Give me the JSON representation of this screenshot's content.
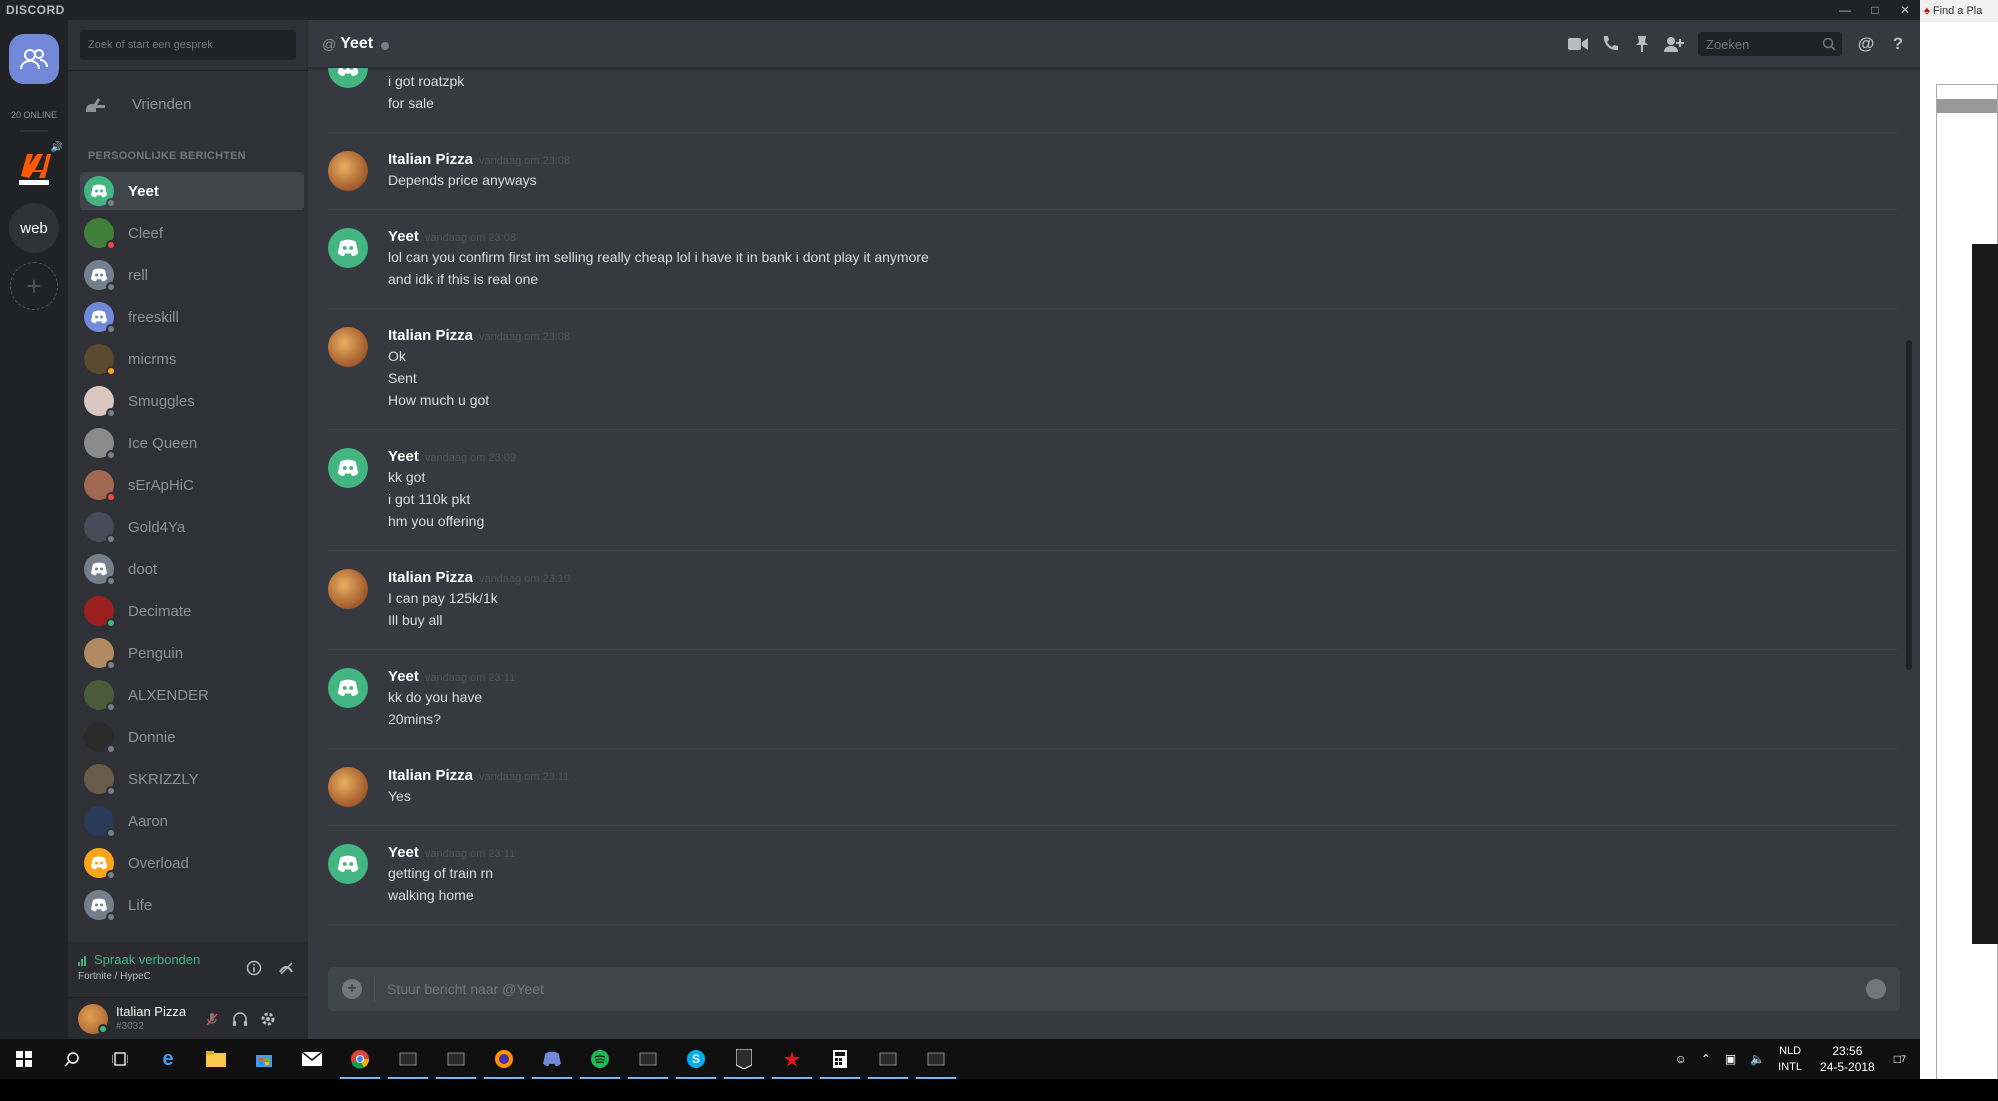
{
  "app": {
    "brand": "DISCORD"
  },
  "guilds": {
    "online_count": "20 ONLINE",
    "web_label": "web",
    "add_label": "+"
  },
  "sidebar": {
    "search_placeholder": "Zoek of start een gesprek",
    "friends_label": "Vrienden",
    "dm_header": "PERSOONLIJKE BERICHTEN",
    "dms": [
      {
        "name": "Yeet",
        "status": "offline",
        "active": true,
        "avatar": "#43b581"
      },
      {
        "name": "Cleef",
        "status": "dnd",
        "active": false,
        "avatar": "#3f7f3a"
      },
      {
        "name": "rell",
        "status": "offline",
        "active": false,
        "avatar": "#747f8d"
      },
      {
        "name": "freeskill",
        "status": "offline",
        "active": false,
        "avatar": "#7289da"
      },
      {
        "name": "micrms",
        "status": "idle",
        "active": false,
        "avatar": "#5a4a2e"
      },
      {
        "name": "Smuggles",
        "status": "offline",
        "active": false,
        "avatar": "#d9c7c0"
      },
      {
        "name": "Ice Queen",
        "status": "offline",
        "active": false,
        "avatar": "#8a8a8a"
      },
      {
        "name": "sErApHiC",
        "status": "dnd",
        "active": false,
        "avatar": "#a06850"
      },
      {
        "name": "Gold4Ya",
        "status": "offline",
        "active": false,
        "avatar": "#4a4a5a"
      },
      {
        "name": "doot",
        "status": "offline",
        "active": false,
        "avatar": "#747f8d"
      },
      {
        "name": "Decimate",
        "status": "online",
        "active": false,
        "avatar": "#9a2020"
      },
      {
        "name": "Penguin",
        "status": "offline",
        "active": false,
        "avatar": "#b08a60"
      },
      {
        "name": "ALXENDER",
        "status": "offline",
        "active": false,
        "avatar": "#4a5a3a"
      },
      {
        "name": "Donnie",
        "status": "offline",
        "active": false,
        "avatar": "#2a2a2a"
      },
      {
        "name": "SKRIZZLY",
        "status": "offline",
        "active": false,
        "avatar": "#6a5a4a"
      },
      {
        "name": "Aaron",
        "status": "offline",
        "active": false,
        "avatar": "#2a3a5a"
      },
      {
        "name": "Overload",
        "status": "offline",
        "active": false,
        "avatar": "#faa61a"
      },
      {
        "name": "Life",
        "status": "offline",
        "active": false,
        "avatar": "#747f8d"
      }
    ],
    "voice": {
      "status": "Spraak verbonden",
      "channel": "Fortnite / HypeC"
    },
    "user": {
      "name": "Italian Pizza",
      "tag": "#3032"
    }
  },
  "chat": {
    "channel_name": "Yeet",
    "search_placeholder": "Zoeken",
    "composer_placeholder": "Stuur bericht naar @Yeet",
    "messages": [
      {
        "author": "",
        "time": "",
        "lines": [
          "i got roatzpk",
          "for sale"
        ],
        "kind": "yeet",
        "partial": true
      },
      {
        "author": "Italian Pizza",
        "time": "vandaag om 23:08",
        "lines": [
          "Depends price anyways"
        ],
        "kind": "pizza"
      },
      {
        "author": "Yeet",
        "time": "vandaag om 23:08",
        "lines": [
          "lol can you confirm first im selling really cheap lol i have it in bank i dont play it anymore",
          "and idk if this is real one"
        ],
        "kind": "yeet"
      },
      {
        "author": "Italian Pizza",
        "time": "vandaag om 23:08",
        "lines": [
          "Ok",
          "Sent",
          "How much u got"
        ],
        "kind": "pizza"
      },
      {
        "author": "Yeet",
        "time": "vandaag om 23:09",
        "lines": [
          "kk got",
          "i got 110k pkt",
          "hm you offering"
        ],
        "kind": "yeet"
      },
      {
        "author": "Italian Pizza",
        "time": "vandaag om 23:10",
        "lines": [
          "I can pay 125k/1k",
          "Ill buy all"
        ],
        "kind": "pizza"
      },
      {
        "author": "Yeet",
        "time": "vandaag om 23:11",
        "lines": [
          "kk do you have",
          "20mins?"
        ],
        "kind": "yeet"
      },
      {
        "author": "Italian Pizza",
        "time": "vandaag om 23:11",
        "lines": [
          "Yes"
        ],
        "kind": "pizza"
      },
      {
        "author": "Yeet",
        "time": "vandaag om 23:11",
        "lines": [
          "getting of train rn",
          "walking home"
        ],
        "kind": "yeet"
      }
    ]
  },
  "sidewindow": {
    "title": "Find a Pla"
  },
  "taskbar": {
    "language": [
      "NLD",
      "INTL"
    ],
    "time": "23:56",
    "date": "24-5-2018",
    "notifications": "7",
    "icons": [
      "windows-start-icon",
      "search-icon",
      "task-view-icon",
      "edge-icon",
      "file-explorer-icon",
      "store-icon",
      "mail-icon",
      "chrome-icon",
      "app-icon",
      "app-icon",
      "firefox-icon",
      "discord-icon",
      "spotify-icon",
      "app-icon",
      "skype-icon",
      "epic-games-icon",
      "pokerstars-icon",
      "calculator-icon",
      "app-icon",
      "app-icon"
    ]
  },
  "colors": {
    "accent": "#7289da",
    "online": "#43b581",
    "idle": "#faa61a",
    "dnd": "#f04747",
    "offline": "#747f8d",
    "bg_chat": "#36393f",
    "bg_sidebar": "#2f3136",
    "bg_guilds": "#202225"
  }
}
